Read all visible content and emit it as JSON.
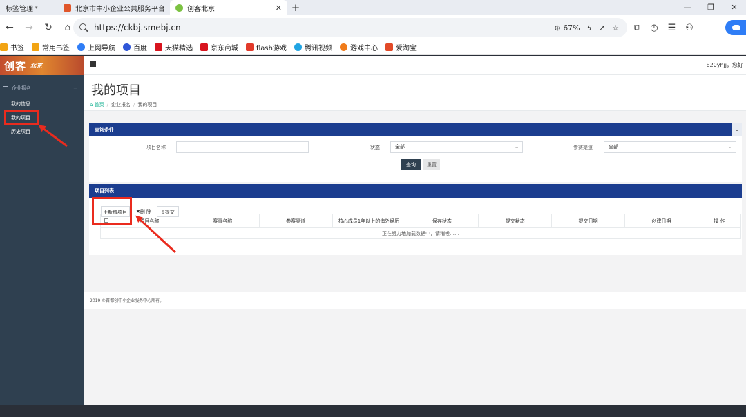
{
  "browser": {
    "bookmark_tab": "标签管理",
    "tabs": [
      {
        "title": "北京市中小企业公共服务平台"
      },
      {
        "title": "创客北京"
      }
    ],
    "url": "https://ckbj.smebj.cn",
    "zoom": "67%",
    "bookmarks": [
      {
        "label": "书签",
        "color": "#f2a413"
      },
      {
        "label": "常用书签",
        "color": "#f2a413"
      },
      {
        "label": "上网导航",
        "color": "#2f7df6"
      },
      {
        "label": "百度",
        "color": "#2f56d8"
      },
      {
        "label": "天猫精选",
        "color": "#d8141e"
      },
      {
        "label": "京东商城",
        "color": "#d8141e"
      },
      {
        "label": "flash游戏",
        "color": "#e23a2b"
      },
      {
        "label": "腾讯视频",
        "color": "#20a4e3"
      },
      {
        "label": "游戏中心",
        "color": "#f07b1a"
      },
      {
        "label": "爱淘宝",
        "color": "#e24a28"
      }
    ]
  },
  "app": {
    "logo": "创客",
    "logo_small": "北京",
    "user_text": "E20yhjj，您好",
    "sidebar": {
      "group_label": "企业报名",
      "items": [
        {
          "label": "我的信息"
        },
        {
          "label": "我的项目"
        },
        {
          "label": "历史项目"
        }
      ]
    },
    "page_title": "我的项目",
    "breadcrumb": {
      "home": "首页",
      "mid": "企业报名",
      "current": "我的项目"
    },
    "query_panel": {
      "title": "查询条件",
      "fields": {
        "project_name_label": "项目名称",
        "project_name_value": "",
        "status_label": "状态",
        "status_value": "全部",
        "channel_label": "参赛渠道",
        "channel_value": "全部"
      },
      "search_button": "查询",
      "reset_button": "重置"
    },
    "list_panel": {
      "title": "项目列表",
      "add_button": "✚新增项目",
      "delete_button": "✖删 除",
      "submit_button": "⇪提交",
      "columns": [
        "项目名称",
        "赛事名称",
        "参赛渠道",
        "核心成员1年以上的海外经历",
        "保存状态",
        "提交状态",
        "提交日期",
        "创建日期",
        "操 作"
      ],
      "loading_text": "正在努力地加载数据中，请稍候……"
    },
    "footer": "2019 ©首都创中小企业服务中心所有。"
  },
  "colors": {
    "annotation": "#ea2b1e",
    "panel_header": "#1b3d8f",
    "sidebar": "#2f4050"
  }
}
